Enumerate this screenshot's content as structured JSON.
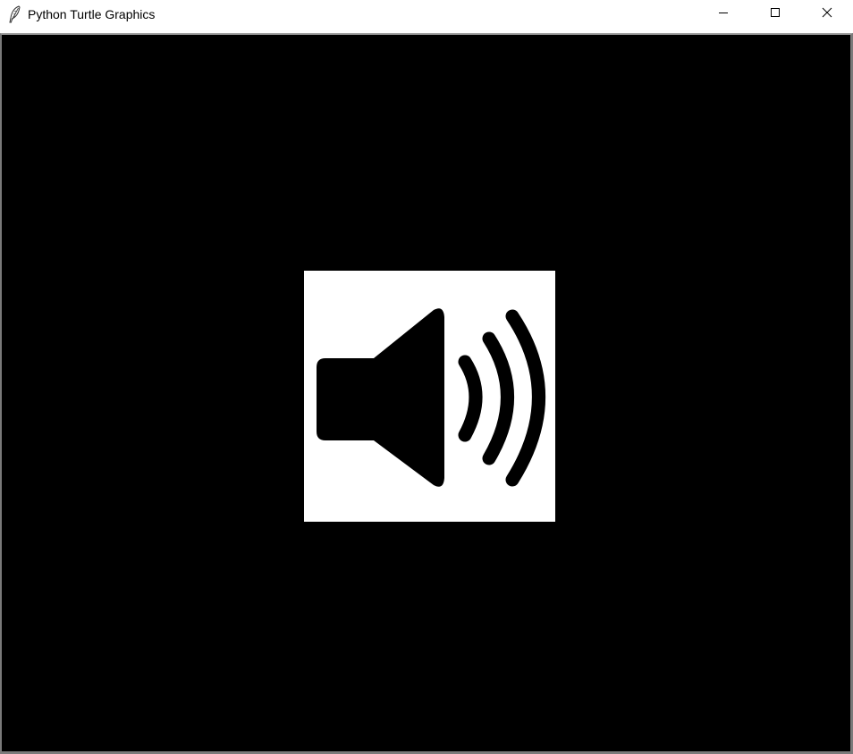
{
  "window": {
    "title": "Python Turtle Graphics",
    "app_icon": "feather-icon",
    "controls": {
      "minimize_icon": "minimize-icon",
      "maximize_icon": "maximize-icon",
      "close_icon": "close-icon"
    }
  },
  "canvas": {
    "background_color": "#000000",
    "image": {
      "icon": "speaker-volume-icon",
      "tile_color": "#ffffff",
      "icon_color": "#000000"
    }
  }
}
